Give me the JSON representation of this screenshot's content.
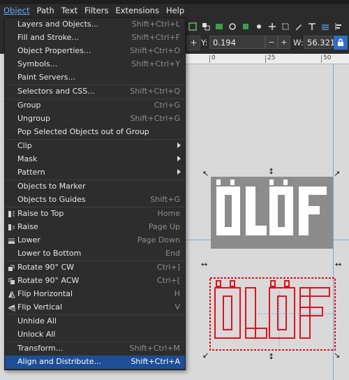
{
  "menubar": {
    "items": [
      {
        "label": "Object"
      },
      {
        "label": "Path"
      },
      {
        "label": "Text"
      },
      {
        "label": "Filters"
      },
      {
        "label": "Extensions"
      },
      {
        "label": "Help"
      }
    ]
  },
  "toolbar": {
    "y_label": "Y:",
    "y_value": "0.194",
    "w_label": "W:",
    "w_value": "56.321",
    "minus_label": "−",
    "plus_label": "+"
  },
  "ruler": {
    "ticks": [
      "0",
      "25",
      "50"
    ]
  },
  "object_menu": {
    "items": [
      {
        "label": "Layers and Objects...",
        "shortcut": "Shift+Ctrl+L"
      },
      {
        "label": "Fill and Stroke...",
        "shortcut": "Shift+Ctrl+F"
      },
      {
        "label": "Object Properties...",
        "shortcut": "Shift+Ctrl+O"
      },
      {
        "label": "Symbols...",
        "shortcut": "Shift+Ctrl+Y"
      },
      {
        "label": "Paint Servers...",
        "shortcut": ""
      },
      {
        "label": "Selectors and CSS...",
        "shortcut": "Shift+Ctrl+Q"
      },
      {
        "label": "Group",
        "shortcut": "Ctrl+G"
      },
      {
        "label": "Ungroup",
        "shortcut": "Shift+Ctrl+G"
      },
      {
        "label": "Pop Selected Objects out of Group",
        "shortcut": ""
      },
      {
        "label": "Clip",
        "shortcut": ""
      },
      {
        "label": "Mask",
        "shortcut": ""
      },
      {
        "label": "Pattern",
        "shortcut": ""
      },
      {
        "label": "Objects to Marker",
        "shortcut": ""
      },
      {
        "label": "Objects to Guides",
        "shortcut": "Shift+G"
      },
      {
        "label": "Raise to Top",
        "shortcut": "Home"
      },
      {
        "label": "Raise",
        "shortcut": "Page Up"
      },
      {
        "label": "Lower",
        "shortcut": "Page Down"
      },
      {
        "label": "Lower to Bottom",
        "shortcut": "End"
      },
      {
        "label": "Rotate 90° CW",
        "shortcut": "Ctrl+]"
      },
      {
        "label": "Rotate 90° ACW",
        "shortcut": "Ctrl+["
      },
      {
        "label": "Flip Horizontal",
        "shortcut": "H"
      },
      {
        "label": "Flip Vertical",
        "shortcut": "V"
      },
      {
        "label": "Unhide All",
        "shortcut": ""
      },
      {
        "label": "Unlock All",
        "shortcut": ""
      },
      {
        "label": "Transform...",
        "shortcut": "Shift+Ctrl+M"
      },
      {
        "label": "Align and Distribute...",
        "shortcut": "Shift+Ctrl+A"
      }
    ]
  },
  "canvas": {
    "logo_text": "ÖLÖF",
    "gray_fill": "#8c8c8c",
    "red_stroke": "#e0101c"
  }
}
